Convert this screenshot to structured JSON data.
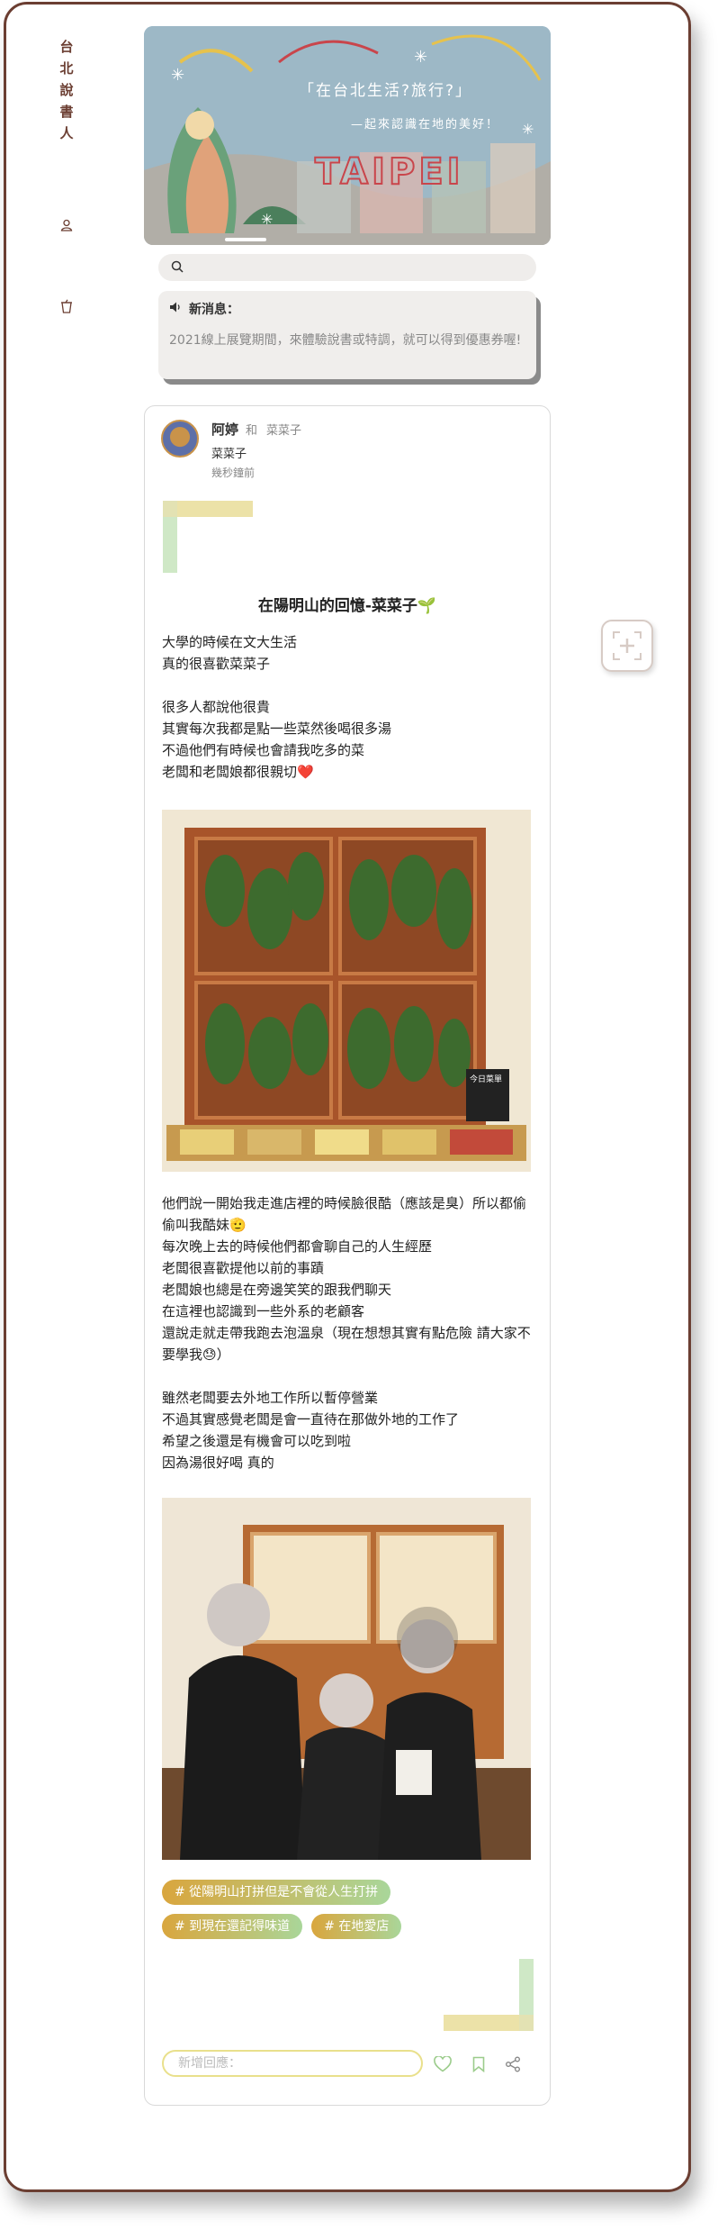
{
  "brand": {
    "chars": [
      "台",
      "北",
      "說",
      "書",
      "人"
    ]
  },
  "sidebar": {
    "icons": [
      "user-icon",
      "cup-icon"
    ]
  },
  "banner": {
    "line1": "「在台北生活?旅行?」",
    "line2": "—起來認識在地的美好！",
    "logo_text": "TAIPEI"
  },
  "search": {
    "placeholder": ""
  },
  "news": {
    "title": "新消息：",
    "body": "2021線上展覽期間，來體驗說書或特調，就可以得到優惠券喔!"
  },
  "post": {
    "author": "阿婷",
    "with_label": "和",
    "tagged": "菜菜子",
    "place": "菜菜子",
    "time": "幾秒鐘前",
    "title": "在陽明山的回憶-菜菜子🌱",
    "paragraph1": "大學的時候在文大生活\n真的很喜歡菜菜子\n\n很多人都說他很貴\n其實每次我都是點一些菜然後喝很多湯\n不過他們有時候也會請我吃多的菜\n老闆和老闆娘都很親切❤️",
    "paragraph2": "他們說一開始我走進店裡的時候臉很酷（應該是臭）所以都偷偷叫我酷妹🫡\n每次晚上去的時候他們都會聊自己的人生經歷\n老闆很喜歡提他以前的事蹟\n老闆娘也總是在旁邊笑笑的跟我們聊天\n在這裡也認識到一些外系的老顧客\n還說走就走帶我跑去泡溫泉（現在想想其實有點危險 請大家不要學我😓）\n\n雖然老闆要去外地工作所以暫停營業\n不過其實感覺老闆是會一直待在那做外地的工作了\n希望之後還是有機會可以吃到啦\n因為湯很好喝 真的",
    "photo1_sign": "今日菜單",
    "tags": [
      "# 從陽明山打拼但是不會從人生打拼",
      "# 到現在還記得味道",
      "# 在地愛店"
    ],
    "comment_placeholder": "新增回應："
  },
  "colors": {
    "brand": "#6b3e32",
    "tag_start": "#d9a63e",
    "tag_end": "#a9d69a",
    "deco_yellow": "#ece2a8",
    "deco_green": "#cfe8c6"
  }
}
